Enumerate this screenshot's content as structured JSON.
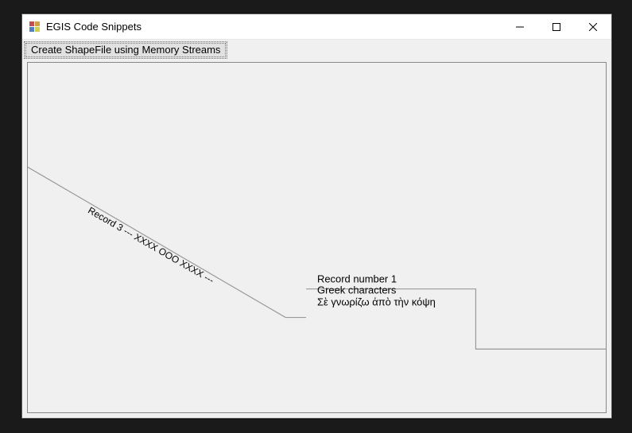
{
  "window": {
    "title": "EGIS Code Snippets"
  },
  "toolbar": {
    "button_label": "Create ShapeFile using Memory Streams"
  },
  "map": {
    "record1": {
      "line1": "Record number 1",
      "line2": "Greek characters",
      "line3": "Σὲ γνωρίζω ἀπὸ τὴν κόψη"
    },
    "record3": {
      "label": "Record 3 --- XXXX OOO XXXX ---"
    }
  }
}
